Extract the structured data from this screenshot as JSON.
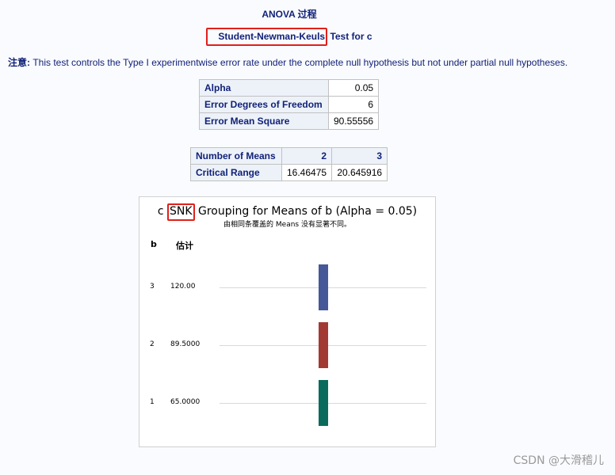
{
  "procedure_title": "ANOVA 过程",
  "test_title_part1": "Student-Newman-Keuls",
  "test_title_part2": " Test for c",
  "note_label": "注意:",
  "note_text": "This test controls the Type I experimentwise error rate under the complete null hypothesis but not under partial null hypotheses.",
  "stats_table": [
    {
      "label": "Alpha",
      "value": "0.05"
    },
    {
      "label": "Error Degrees of Freedom",
      "value": "6"
    },
    {
      "label": "Error Mean Square",
      "value": "90.55556"
    }
  ],
  "range_table": {
    "header_label": "Number of Means",
    "header_values": [
      "2",
      "3"
    ],
    "row_label": "Critical Range",
    "row_values": [
      "16.46475",
      "20.645916"
    ]
  },
  "chart_data": {
    "type": "table",
    "title_prefix": "c ",
    "title_highlight": "SNK",
    "title_suffix": " Grouping for Means of b (Alpha = 0.05)",
    "subtitle": "由相同条覆盖的 Means 没有显著不同。",
    "col_headers": [
      "b",
      "估计"
    ],
    "rows": [
      {
        "b": "3",
        "estimate": "120.00",
        "group_color": "#465897"
      },
      {
        "b": "2",
        "estimate": "89.5000",
        "group_color": "#a23a33"
      },
      {
        "b": "1",
        "estimate": "65.0000",
        "group_color": "#0a6b5d"
      }
    ]
  },
  "watermark": "CSDN @大滑稽儿",
  "colors": {
    "highlight_box": "#e0201a",
    "text": "#112277",
    "header_bg": "#edf2f9"
  }
}
